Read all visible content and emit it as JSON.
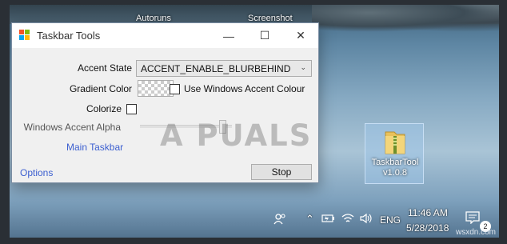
{
  "desktop": {
    "top_labels": [
      "Autoruns",
      "Screenshot"
    ],
    "icon": {
      "name_line1": "TaskbarTool",
      "name_line2": "v1.0.8"
    },
    "watermark": "A PUALS",
    "site": "wsxdn.com"
  },
  "window": {
    "title": "Taskbar Tools",
    "controls": {
      "minimize": "—",
      "maximize": "☐",
      "close": "✕"
    },
    "accent_state_label": "Accent State",
    "accent_state_value": "ACCENT_ENABLE_BLURBEHIND",
    "gradient_color_label": "Gradient Color",
    "use_windows_accent_label": "Use Windows Accent Colour",
    "colorize_label": "Colorize",
    "accent_alpha_label": "Windows Accent Alpha",
    "main_taskbar_link": "Main Taskbar",
    "options_link": "Options",
    "stop_button": "Stop"
  },
  "tray": {
    "language": "ENG",
    "time": "11:46 AM",
    "date": "5/28/2018",
    "notifications_count": "2"
  }
}
